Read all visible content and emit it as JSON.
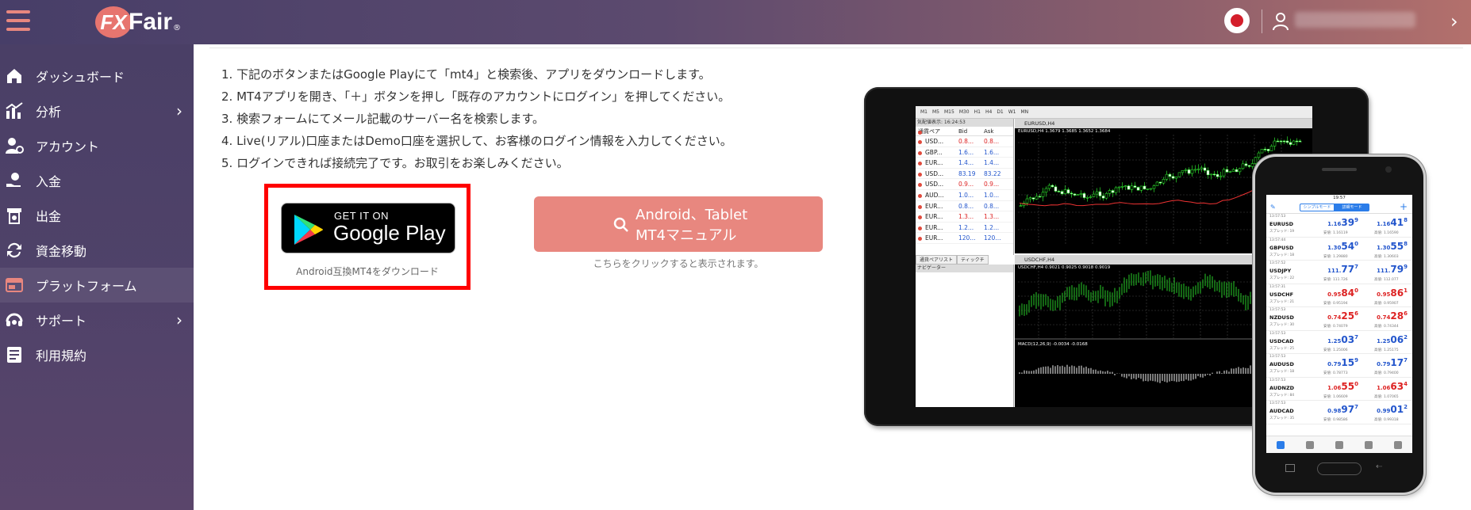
{
  "header": {
    "brand_badge": "FX",
    "brand_name": "Fair",
    "brand_mark": "®",
    "language_flag": "japan-flag",
    "accent_color": "#e8877f"
  },
  "sidebar": {
    "items": [
      {
        "label": "ダッシュボード",
        "icon": "home-icon",
        "chevron": ""
      },
      {
        "label": "分析",
        "icon": "chart-icon",
        "chevron": "›"
      },
      {
        "label": "アカウント",
        "icon": "account-icon",
        "chevron": ""
      },
      {
        "label": "入金",
        "icon": "deposit-icon",
        "chevron": ""
      },
      {
        "label": "出金",
        "icon": "withdraw-icon",
        "chevron": ""
      },
      {
        "label": "資金移動",
        "icon": "transfer-icon",
        "chevron": ""
      },
      {
        "label": "プラットフォーム",
        "icon": "platform-icon",
        "chevron": ""
      },
      {
        "label": "サポート",
        "icon": "support-icon",
        "chevron": "›"
      },
      {
        "label": "利用規約",
        "icon": "terms-icon",
        "chevron": ""
      }
    ],
    "active_index": 6
  },
  "main": {
    "steps": [
      "1. 下記のボタンまたはGoogle Playにて「mt4」と検索後、アプリをダウンロードします。",
      "2. MT4アプリを開き、「＋」ボタンを押し「既存のアカウントにログイン」を押してください。",
      "3. 検索フォームにてメール記載のサーバー名を検索します。",
      "4. Live(リアル)口座またはDemo口座を選択して、お客様のログイン情報を入力してください。",
      "5. ログインできれば接続完了です。お取引をお楽しみください。"
    ],
    "google_play": {
      "small": "GET IT ON",
      "big": "Google Play",
      "caption": "Android互換MT4をダウンロード"
    },
    "manual": {
      "line1": "Android、Tablet",
      "line2": "MT4マニュアル",
      "caption": "こちらをクリックすると表示されます。"
    }
  },
  "tablet": {
    "toolbar": [
      "M1",
      "M5",
      "M15",
      "M30",
      "H1",
      "H4",
      "D1",
      "W1",
      "MN"
    ],
    "watch_title": "気配値表示: 16:24:53",
    "watch_headers": [
      "通貨ペア",
      "Bid",
      "Ask"
    ],
    "watch_rows": [
      {
        "sym": "USD...",
        "bid": "0.8...",
        "ask": "0.8...",
        "color": "red"
      },
      {
        "sym": "GBP...",
        "bid": "1.6...",
        "ask": "1.6...",
        "color": "blue"
      },
      {
        "sym": "EUR...",
        "bid": "1.4...",
        "ask": "1.4...",
        "color": "blue"
      },
      {
        "sym": "USD...",
        "bid": "83.19",
        "ask": "83.22",
        "color": "blue"
      },
      {
        "sym": "USD...",
        "bid": "0.9...",
        "ask": "0.9...",
        "color": "red"
      },
      {
        "sym": "AUD...",
        "bid": "1.0...",
        "ask": "1.0...",
        "color": "blue"
      },
      {
        "sym": "EUR...",
        "bid": "0.8...",
        "ask": "0.8...",
        "color": "blue"
      },
      {
        "sym": "EUR...",
        "bid": "1.3...",
        "ask": "1.3...",
        "color": "red"
      },
      {
        "sym": "EUR...",
        "bid": "1.2...",
        "ask": "1.2...",
        "color": "blue"
      },
      {
        "sym": "EUR...",
        "bid": "120...",
        "ask": "120...",
        "color": "blue"
      }
    ],
    "watch_tabs": [
      "通貨ペアリスト",
      "ティックチ"
    ],
    "navigator_title": "ナビゲーター",
    "chart1_title": "EURUSD,H4",
    "chart1_sub": "EURUSD,H4  1.3679 1.3685 1.3652 1.3684",
    "chart2_title": "USDCHF,H4",
    "chart2_sub": "USDCHF,H4  0.9021 0.9025 0.9018 0.9019",
    "macd_label": "MACD(12,26,9) -0.0034 -0.0168"
  },
  "phone": {
    "status_time": "19:57",
    "tab_simple": "シンプルモード",
    "tab_detail": "詳細モード",
    "quotes": [
      {
        "time": "13:57:53",
        "sym": "EURUSD",
        "spread": "スプレッド: 19",
        "bid_main": "1.16",
        "bid_big": "39",
        "bid_sup": "9",
        "ask_main": "1.16",
        "ask_big": "41",
        "ask_sup": "8",
        "low": "安値: 1.16119",
        "high": "高値: 1.16590",
        "color": "blue"
      },
      {
        "time": "13:57:44",
        "sym": "GBPUSD",
        "spread": "スプレッド: 18",
        "bid_main": "1.30",
        "bid_big": "54",
        "bid_sup": "0",
        "ask_main": "1.30",
        "ask_big": "55",
        "ask_sup": "8",
        "low": "安値: 1.29880",
        "high": "高値: 1.30603",
        "color": "blue"
      },
      {
        "time": "13:57:52",
        "sym": "USDJPY",
        "spread": "スプレッド: 22",
        "bid_main": "111.",
        "bid_big": "77",
        "bid_sup": "7",
        "ask_main": "111.",
        "ask_big": "79",
        "ask_sup": "9",
        "low": "安値: 111.726",
        "high": "高値: 112.077",
        "color": "blue"
      },
      {
        "time": "13:57:31",
        "sym": "USDCHF",
        "spread": "スプレッド: 21",
        "bid_main": "0.95",
        "bid_big": "84",
        "bid_sup": "0",
        "ask_main": "0.95",
        "ask_big": "86",
        "ask_sup": "1",
        "low": "安値: 0.95194",
        "high": "高値: 0.95907",
        "color": "red"
      },
      {
        "time": "13:57:53",
        "sym": "NZDUSD",
        "spread": "スプレッド: 30",
        "bid_main": "0.74",
        "bid_big": "25",
        "bid_sup": "6",
        "ask_main": "0.74",
        "ask_big": "28",
        "ask_sup": "6",
        "low": "安値: 0.74079",
        "high": "高値: 0.74344",
        "color": "red"
      },
      {
        "time": "13:57:53",
        "sym": "USDCAD",
        "spread": "スプレッド: 25",
        "bid_main": "1.25",
        "bid_big": "03",
        "bid_sup": "7",
        "ask_main": "1.25",
        "ask_big": "06",
        "ask_sup": "2",
        "low": "安値: 1.25006",
        "high": "高値: 1.25175",
        "color": "blue"
      },
      {
        "time": "13:57:53",
        "sym": "AUDUSD",
        "spread": "スプレッド: 18",
        "bid_main": "0.79",
        "bid_big": "15",
        "bid_sup": "9",
        "ask_main": "0.79",
        "ask_big": "17",
        "ask_sup": "7",
        "low": "安値: 0.78773",
        "high": "高値: 0.79400",
        "color": "blue"
      },
      {
        "time": "13:57:53",
        "sym": "AUDNZD",
        "spread": "スプレッド: 84",
        "bid_main": "1.06",
        "bid_big": "55",
        "bid_sup": "0",
        "ask_main": "1.06",
        "ask_big": "63",
        "ask_sup": "4",
        "low": "安値: 1.06609",
        "high": "高値: 1.07065",
        "color": "red"
      },
      {
        "time": "13:57:53",
        "sym": "AUDCAD",
        "spread": "スプレッド: 35",
        "bid_main": "0.98",
        "bid_big": "97",
        "bid_sup": "7",
        "ask_main": "0.99",
        "ask_big": "01",
        "ask_sup": "2",
        "low": "安値: 0.98586",
        "high": "高値: 0.99318",
        "color": "blue"
      }
    ]
  }
}
